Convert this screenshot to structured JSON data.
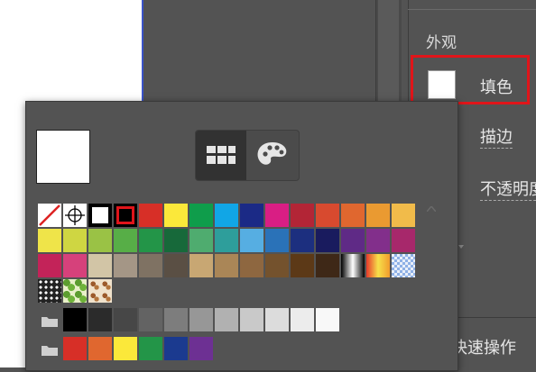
{
  "appearance_panel": {
    "section_title": "外观",
    "fill_label": "填色",
    "stroke_label": "描边",
    "opacity_label": "不透明度",
    "actions_label": "快速操作",
    "fill_color": "#ffffff"
  },
  "swatch_popup": {
    "current_fill": "#ffffff",
    "active_view": "swatches",
    "special_swatches": [
      {
        "name": "none-swatch-icon",
        "type": "none"
      },
      {
        "name": "registration-swatch-icon",
        "type": "registration"
      },
      {
        "name": "white-swatch",
        "type": "white"
      },
      {
        "name": "black-swatch",
        "type": "black-selected"
      }
    ],
    "row1_colors": [
      "#d72f27",
      "#fbe83a",
      "#0f9d4b",
      "#11a6e6",
      "#1b2a86",
      "#d91e84",
      "#b32536",
      "#d84a2f",
      "#e0672f",
      "#ea9a31",
      "#f1bb4a"
    ],
    "row2_colors": [
      "#efe449",
      "#cfd642",
      "#9ac245",
      "#57ae47",
      "#239548",
      "#17693a",
      "#4fac6f",
      "#2e9e9b",
      "#56aee2",
      "#2a72b8",
      "#1c2f7f",
      "#191b5e",
      "#5f2a86",
      "#822f8b",
      "#a7286b"
    ],
    "row3_colors": [
      "#c32359",
      "#d6417b",
      "#d2c5a6",
      "#a49686",
      "#7f7263",
      "#5a4f44",
      "#c8a773",
      "#aa8657",
      "#8e6740",
      "#74522d",
      "#5c3917",
      "#3e2817"
    ],
    "row3_gradients": [
      "gradient-white-black",
      "gradient-orange-yellow",
      "gradient-blue-white"
    ],
    "patterns": [
      "dots-pattern",
      "leaf-pattern",
      "paisley-pattern"
    ],
    "gray_group": [
      "#000000",
      "#2b2b2b",
      "#474747",
      "#636363",
      "#7d7d7d",
      "#979797",
      "#b1b1b1",
      "#c9c9c9",
      "#dcdcdc",
      "#ececec",
      "#f8f8f8"
    ],
    "color_group": [
      "#d72f27",
      "#e0672f",
      "#fbe83a",
      "#239548",
      "#1b3a8f",
      "#6d3093"
    ]
  }
}
